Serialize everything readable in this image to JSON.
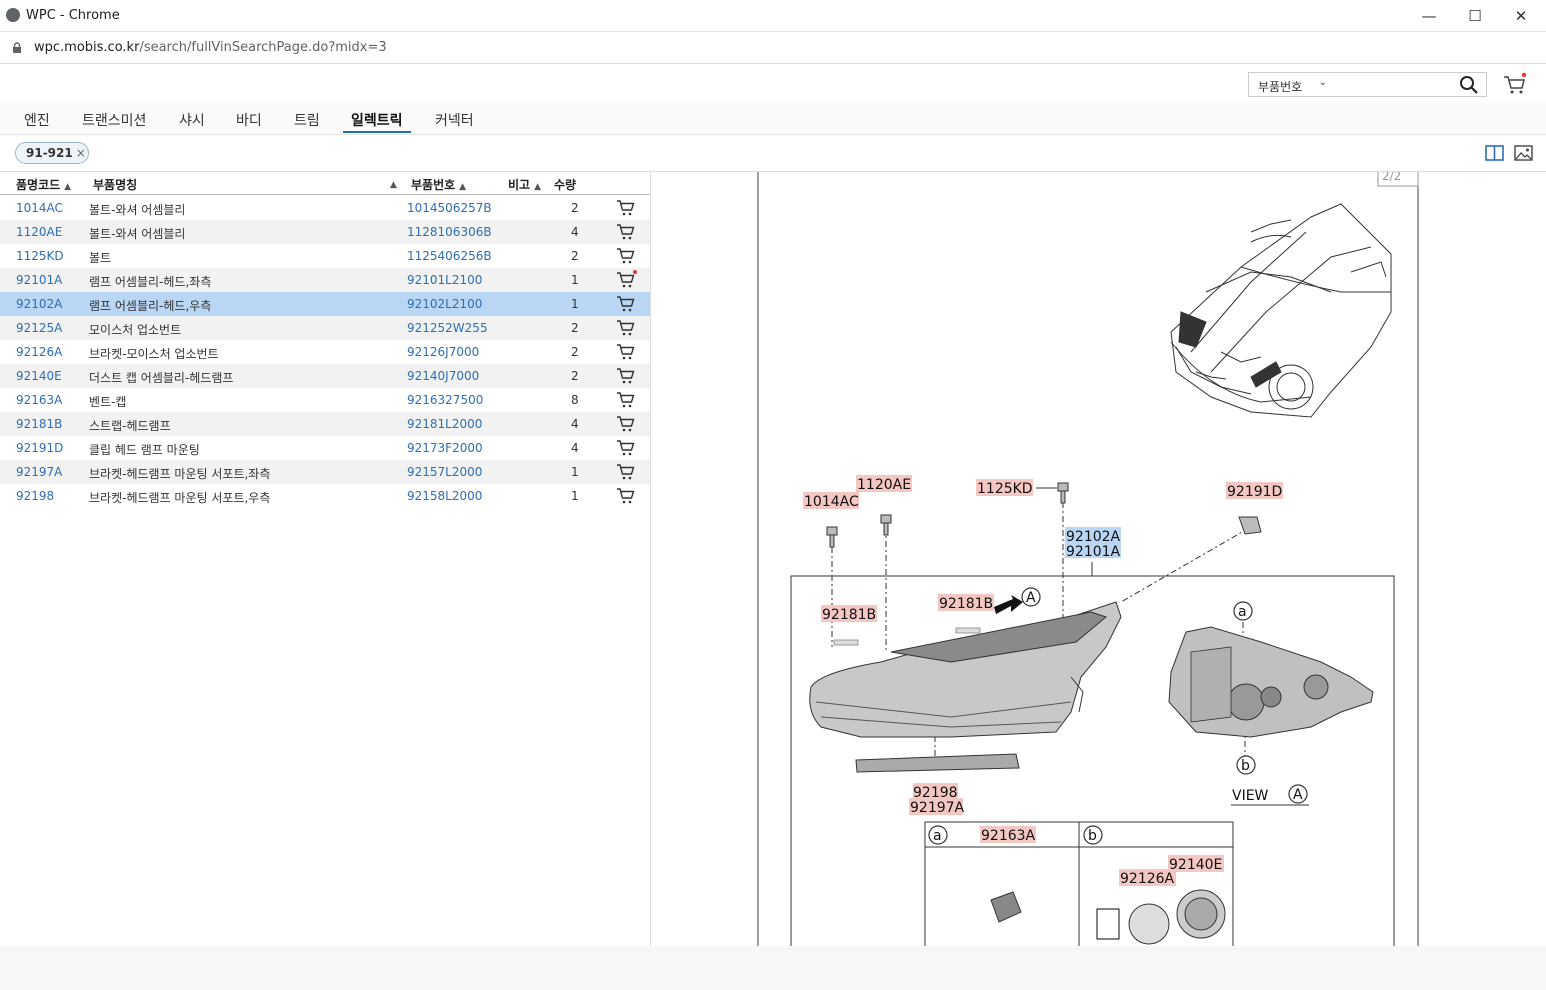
{
  "window": {
    "title": "WPC - Chrome",
    "minimize": "—",
    "maximize": "☐",
    "close": "✕"
  },
  "address": {
    "host": "wpc.mobis.co.kr",
    "path": "/search/fullVinSearchPage.do?midx=3"
  },
  "search": {
    "type_label": "부품번호",
    "value": ""
  },
  "tabs": [
    {
      "label": "엔진"
    },
    {
      "label": "트랜스미션"
    },
    {
      "label": "샤시"
    },
    {
      "label": "바디"
    },
    {
      "label": "트림"
    },
    {
      "label": "일렉트릭",
      "active": true
    },
    {
      "label": "커넥터"
    }
  ],
  "filter": {
    "chip": "91-921",
    "chip_close": "×"
  },
  "table": {
    "headers": {
      "code": "품명코드",
      "name": "부품명칭",
      "part_no": "부품번호",
      "note": "비고",
      "qty": "수량"
    },
    "rows": [
      {
        "code": "1014AC",
        "name": "볼트-와셔 어셈블리",
        "part_no": "1014506257B",
        "qty": "2"
      },
      {
        "code": "1120AE",
        "name": "볼트-와셔 어셈블리",
        "part_no": "1128106306B",
        "qty": "4"
      },
      {
        "code": "1125KD",
        "name": "볼트",
        "part_no": "1125406256B",
        "qty": "2"
      },
      {
        "code": "92101A",
        "name": "램프 어셈블리-헤드,좌측",
        "part_no": "92101L2100",
        "qty": "1",
        "cart_dot": true
      },
      {
        "code": "92102A",
        "name": "램프 어셈블리-헤드,우측",
        "part_no": "92102L2100",
        "qty": "1",
        "selected": true
      },
      {
        "code": "92125A",
        "name": "모이스처 업소번트",
        "part_no": "921252W255",
        "qty": "2"
      },
      {
        "code": "92126A",
        "name": "브라켓-모이스처 업소번트",
        "part_no": "92126J7000",
        "qty": "2"
      },
      {
        "code": "92140E",
        "name": "더스트 캡 어셈블리-헤드램프",
        "part_no": "92140J7000",
        "qty": "2"
      },
      {
        "code": "92163A",
        "name": "벤트-캡",
        "part_no": "9216327500",
        "qty": "8"
      },
      {
        "code": "92181B",
        "name": "스트랩-헤드램프",
        "part_no": "92181L2000",
        "qty": "4"
      },
      {
        "code": "92191D",
        "name": "클립 헤드 램프 마운팅",
        "part_no": "92173F2000",
        "qty": "4"
      },
      {
        "code": "92197A",
        "name": "브라켓-헤드램프 마운팅 서포트,좌측",
        "part_no": "92157L2000",
        "qty": "1"
      },
      {
        "code": "92198",
        "name": "브라켓-헤드램프 마운팅 서포트,우측",
        "part_no": "92158L2000",
        "qty": "1"
      }
    ]
  },
  "diagram": {
    "page_indicator": "2/2",
    "labels": {
      "l1014AC": "1014AC",
      "l1120AE": "1120AE",
      "l1125KD": "1125KD",
      "l92191D": "92191D",
      "l92102A": "92102A",
      "l92101A": "92101A",
      "l92181B_a": "92181B",
      "l92181B_b": "92181B",
      "l92198": "92198",
      "l92197A": "92197A",
      "l92163A": "92163A",
      "l92126A": "92126A",
      "l92140E": "92140E",
      "view": "VIEW",
      "ref_A": "A",
      "ref_a": "a",
      "ref_b": "b"
    }
  },
  "colors": {
    "link": "#2f6db5",
    "selected_row": "#b9d6f5",
    "label_highlight": "#f4c7c3",
    "label_selected": "#b9d6f5"
  }
}
